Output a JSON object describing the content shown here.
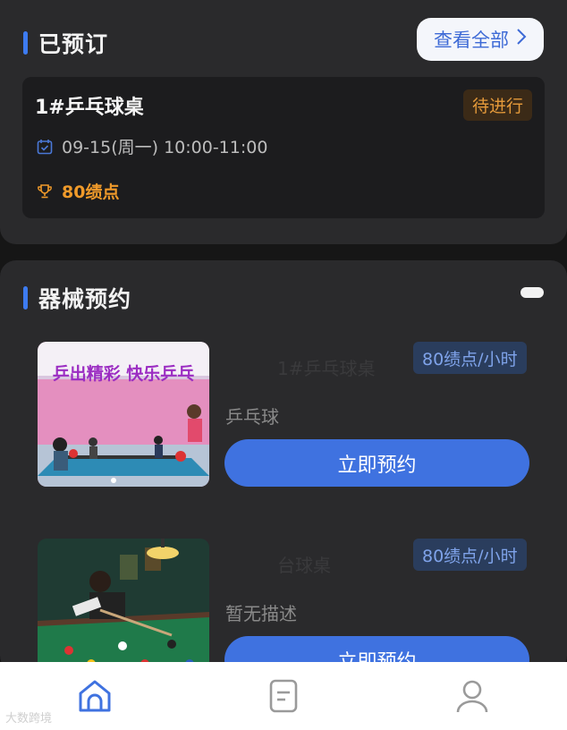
{
  "booked": {
    "title": "已预订",
    "view_all_label": "查看全部",
    "item": {
      "name": "1#乒乓球桌",
      "status": "待进行",
      "time": "09-15(周一) 10:00-11:00",
      "points": "80绩点"
    }
  },
  "equipment": {
    "title": "器械预约",
    "items": [
      {
        "name": "1#乒乓球桌",
        "price": "80绩点/小时",
        "description": "乒乓球",
        "button": "立即预约",
        "image_text": "乒出精彩 快乐乒乓"
      },
      {
        "name": "台球桌",
        "price": "80绩点/小时",
        "description": "暂无描述",
        "button": "立即预约"
      }
    ]
  },
  "tabbar": {
    "tabs": [
      {
        "icon": "home-icon",
        "active": true
      },
      {
        "icon": "orders-icon",
        "active": false
      },
      {
        "icon": "user-icon",
        "active": false
      }
    ],
    "watermark": "大数跨境"
  },
  "colors": {
    "accent": "#3f72e0",
    "status_orange": "#e59a3a",
    "background": "#161616",
    "card": "#2a2a2c"
  }
}
